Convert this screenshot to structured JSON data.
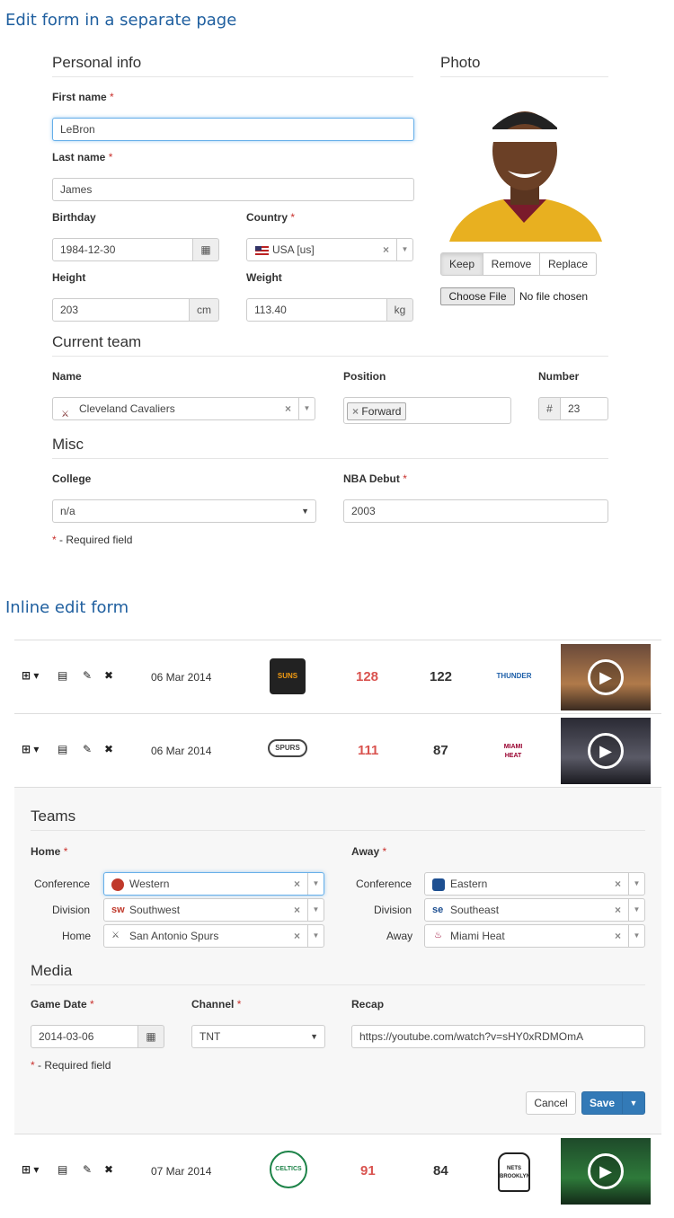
{
  "sections": {
    "separate": "Edit form in a separate page",
    "inline": "Inline edit form"
  },
  "personal": {
    "legend": "Personal info",
    "first_label": "First name",
    "first_value": "LeBron",
    "last_label": "Last name",
    "last_value": "James",
    "birthday_label": "Birthday",
    "birthday_value": "1984-12-30",
    "country_label": "Country",
    "country_value": "USA [us]",
    "height_label": "Height",
    "height_value": "203",
    "height_unit": "cm",
    "weight_label": "Weight",
    "weight_value": "113.40",
    "weight_unit": "kg"
  },
  "photo": {
    "legend": "Photo",
    "keep": "Keep",
    "remove": "Remove",
    "replace": "Replace",
    "choose": "Choose File",
    "nofile": "No file chosen"
  },
  "team": {
    "legend": "Current team",
    "name_label": "Name",
    "name_value": "Cleveland Cavaliers",
    "position_label": "Position",
    "position_tag": "Forward",
    "number_label": "Number",
    "number_prefix": "#",
    "number_value": "23"
  },
  "misc": {
    "legend": "Misc",
    "college_label": "College",
    "college_value": "n/a",
    "debut_label": "NBA Debut",
    "debut_value": "2003"
  },
  "required_note": "- Required field",
  "req_mark": "*",
  "games": [
    {
      "date": "06 Mar 2014",
      "home_score": "128",
      "away_score": "122",
      "home_logo": "SUNS",
      "away_logo": "THUNDER"
    },
    {
      "date": "06 Mar 2014",
      "home_score": "111",
      "away_score": "87",
      "home_logo": "SPURS",
      "away_logo": "MIAMI HEAT"
    },
    {
      "date": "07 Mar 2014",
      "home_score": "91",
      "away_score": "84",
      "home_logo": "CELTICS",
      "away_logo": "NETS BROOKLYN"
    }
  ],
  "inline": {
    "teams_legend": "Teams",
    "home_label": "Home",
    "away_label": "Away",
    "conference_label": "Conference",
    "division_label": "Division",
    "home_row_label": "Home",
    "away_row_label": "Away",
    "home_conference": "Western",
    "home_division": "Southwest",
    "home_division_abbr": "sw",
    "home_team": "San Antonio Spurs",
    "away_conference": "Eastern",
    "away_division": "Southeast",
    "away_division_abbr": "se",
    "away_team": "Miami Heat",
    "media_legend": "Media",
    "date_label": "Game Date",
    "date_value": "2014-03-06",
    "channel_label": "Channel",
    "channel_value": "TNT",
    "recap_label": "Recap",
    "recap_value": "https://youtube.com/watch?v=sHY0xRDMOmA",
    "cancel": "Cancel",
    "save": "Save"
  },
  "colors": {
    "accent": "#337ab7",
    "score_red": "#d9534f",
    "heading": "#1f5f9f"
  }
}
